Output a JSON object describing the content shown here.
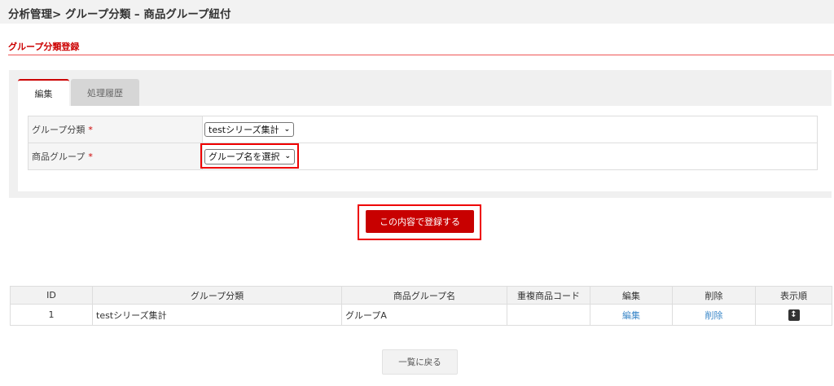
{
  "header": {
    "title": "分析管理> グループ分類 – 商品グループ紐付"
  },
  "section": {
    "title": "グループ分類登録"
  },
  "tabs": [
    {
      "label": "編集"
    },
    {
      "label": "処理履歴"
    }
  ],
  "form": {
    "group_class": {
      "label": "グループ分類",
      "required": "*",
      "value": "testシリーズ集計"
    },
    "product_group": {
      "label": "商品グループ",
      "required": "*",
      "value": "グループ名を選択"
    }
  },
  "submit_label": "この内容で登録する",
  "table": {
    "headers": [
      "ID",
      "グループ分類",
      "商品グループ名",
      "重複商品コード",
      "編集",
      "削除",
      "表示順"
    ],
    "rows": [
      {
        "id": "1",
        "group_class": "testシリーズ集計",
        "product_group": "グループA",
        "dup_code": "",
        "edit": "編集",
        "delete": "削除",
        "order_icon": "↕"
      }
    ]
  },
  "back_label": "一覧に戻る",
  "colors": {
    "accent": "#cc0000",
    "link": "#3a87c8"
  }
}
